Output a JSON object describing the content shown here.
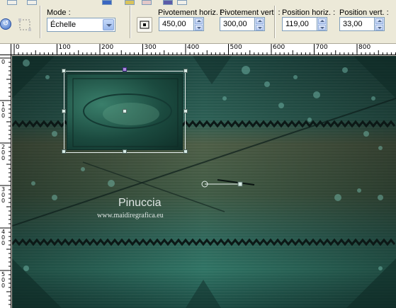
{
  "toolbar": {
    "mode_label": "Mode :",
    "mode_value": "Échelle",
    "fields": [
      {
        "label": "Pivotement horiz. :",
        "value": "450,00"
      },
      {
        "label": "Pivotement vert. :",
        "value": "300,00"
      },
      {
        "label": "Position horiz. :",
        "value": "119,00"
      },
      {
        "label": "Position vert. :",
        "value": "33,00"
      }
    ]
  },
  "ruler": {
    "top_labels": [
      "0",
      "100",
      "200",
      "300",
      "400",
      "500",
      "600",
      "700",
      "800"
    ],
    "left_labels": [
      "0",
      "100",
      "200",
      "300",
      "400",
      "500"
    ]
  },
  "canvas": {
    "watermark_title": "Pinuccia",
    "watermark_site": "www.maidiregrafica.eu",
    "colors": {
      "base": "#1f4a43",
      "light": "#4f8f7c",
      "dark": "#0d2420"
    }
  }
}
